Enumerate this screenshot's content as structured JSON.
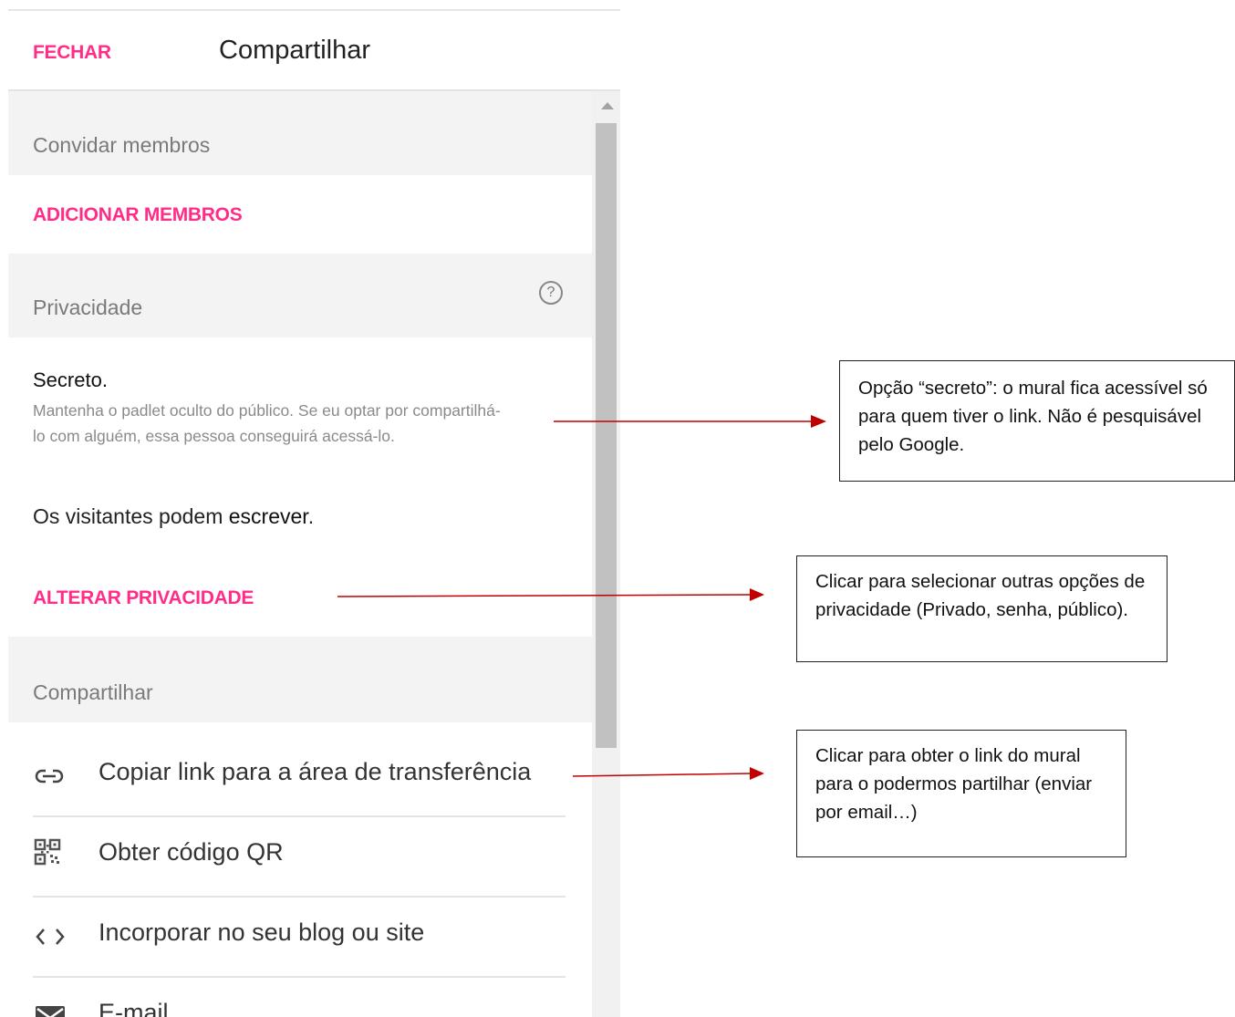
{
  "header": {
    "close_label": "FECHAR",
    "title": "Compartilhar"
  },
  "invite": {
    "section_title": "Convidar membros",
    "add_members_label": "ADICIONAR MEMBROS"
  },
  "privacy": {
    "section_title": "Privacidade",
    "help_glyph": "?",
    "level_name": "Secreto",
    "level_period": ".",
    "level_description": "Mantenha o padlet oculto do público. Se eu optar por compartilhá-lo com alguém, essa pessoa conseguirá acessá-lo.",
    "visitors_prefix": "Os visitantes podem ",
    "visitors_permission": "escrever",
    "visitors_suffix": ".",
    "change_label": "ALTERAR PRIVACIDADE"
  },
  "share": {
    "section_title": "Compartilhar",
    "items": [
      {
        "label": "Copiar link para a área de transferência",
        "icon": "link-icon"
      },
      {
        "label": "Obter código QR",
        "icon": "qr-code-icon"
      },
      {
        "label": "Incorporar no seu blog ou site",
        "icon": "code-icon"
      },
      {
        "label": "E-mail",
        "icon": "envelope-icon"
      }
    ]
  },
  "annotations": [
    {
      "text": "Opção “secreto”: o mural fica acessível só para quem tiver o link. Não é pesquisável pelo Google."
    },
    {
      "text": "Clicar para selecionar outras opções de privacidade (Privado, senha, público)."
    },
    {
      "text": "Clicar para obter o link do mural para o podermos partilhar (enviar por email…)"
    }
  ],
  "colors": {
    "accent": "#ff2d87",
    "arrow": "#c00000",
    "section_bg": "#f3f3f3"
  }
}
